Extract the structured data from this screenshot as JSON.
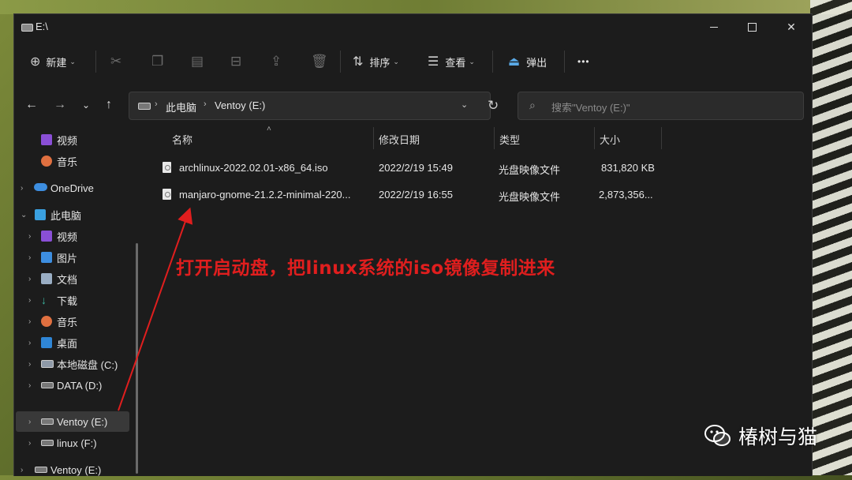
{
  "window": {
    "title": "E:\\"
  },
  "toolbar": {
    "new_label": "新建",
    "sort_label": "排序",
    "view_label": "查看",
    "eject_label": "弹出",
    "more_label": "•••"
  },
  "address": {
    "crumbs": [
      "此电脑",
      "Ventoy (E:)"
    ],
    "search_placeholder": "搜索\"Ventoy (E:)\""
  },
  "sidebar": {
    "items": [
      {
        "label": "视频",
        "icon": "video-icon"
      },
      {
        "label": "音乐",
        "icon": "music-icon"
      },
      {
        "label": "OneDrive",
        "icon": "onedrive-icon"
      },
      {
        "label": "此电脑",
        "icon": "computer-icon"
      },
      {
        "label": "视频",
        "icon": "video-icon"
      },
      {
        "label": "图片",
        "icon": "pictures-icon"
      },
      {
        "label": "文档",
        "icon": "documents-icon"
      },
      {
        "label": "下载",
        "icon": "download-icon"
      },
      {
        "label": "音乐",
        "icon": "music-icon"
      },
      {
        "label": "桌面",
        "icon": "desktop-icon"
      },
      {
        "label": "本地磁盘 (C:)",
        "icon": "drive-c-icon"
      },
      {
        "label": "DATA (D:)",
        "icon": "drive-icon"
      },
      {
        "label": "Ventoy (E:)",
        "icon": "drive-icon",
        "selected": true
      },
      {
        "label": "linux (F:)",
        "icon": "drive-icon"
      },
      {
        "label": "Ventoy (E:)",
        "icon": "drive-icon"
      }
    ]
  },
  "columns": {
    "name": "名称",
    "modified": "修改日期",
    "type": "类型",
    "size": "大小"
  },
  "files": [
    {
      "name": "archlinux-2022.02.01-x86_64.iso",
      "modified": "2022/2/19 15:49",
      "type": "光盘映像文件",
      "size": "831,820 KB"
    },
    {
      "name": "manjaro-gnome-21.2.2-minimal-220...",
      "modified": "2022/2/19 16:55",
      "type": "光盘映像文件",
      "size": "2,873,356..."
    }
  ],
  "annotation": {
    "text": "打开启动盘，把linux系统的iso镜像复制进来",
    "color": "#e01e1e"
  },
  "watermark": {
    "text": "椿树与猫"
  }
}
